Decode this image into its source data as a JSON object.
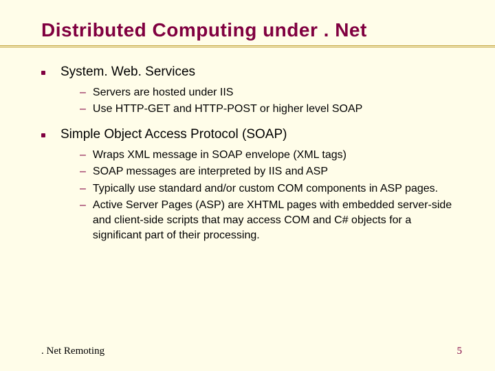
{
  "title": "Distributed Computing under . Net",
  "bullets": [
    {
      "text": "System. Web. Services",
      "subs": [
        "Servers are hosted under IIS",
        "Use HTTP-GET and HTTP-POST or higher level SOAP"
      ]
    },
    {
      "text": "Simple Object Access Protocol (SOAP)",
      "subs": [
        "Wraps XML message in SOAP envelope (XML tags)",
        "SOAP messages are interpreted by IIS and ASP",
        "Typically use standard and/or custom COM components in ASP pages.",
        "Active Server Pages (ASP) are XHTML pages with embedded server-side and client-side scripts that may access COM and C# objects for a significant part of their processing."
      ]
    }
  ],
  "footer": {
    "left": ". Net Remoting",
    "right": "5"
  },
  "colors": {
    "background": "#fffde9",
    "accent": "#800040",
    "rule": "#c0a030"
  }
}
